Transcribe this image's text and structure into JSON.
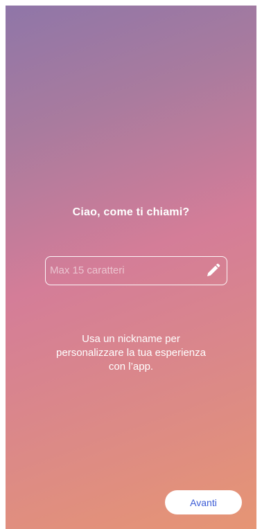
{
  "onboarding": {
    "title": "Ciao, come ti chiami?",
    "nickname_input": {
      "value": "",
      "placeholder": "Max 15 caratteri"
    },
    "edit_icon": "pencil-icon",
    "helper_text": "Usa un nickname per personalizzare la tua esperienza con l’app.",
    "next_label": "Avanti"
  },
  "colors": {
    "gradient_top": "#8f76a8",
    "gradient_middle": "#d47d98",
    "gradient_bottom": "#e69574",
    "button_text": "#3b5bd6",
    "text": "#ffffff"
  }
}
